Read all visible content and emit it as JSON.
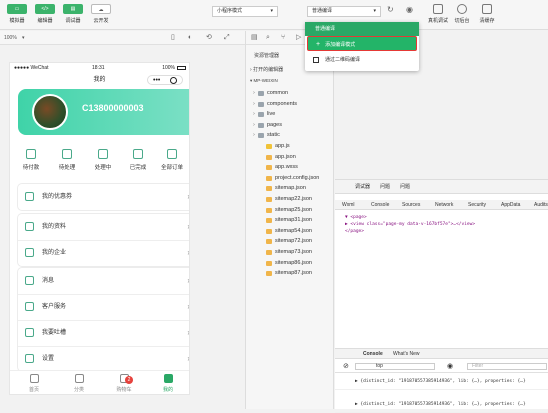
{
  "toolbar": {
    "left_buttons": [
      {
        "label": "模拟器",
        "icon": "phone-icon"
      },
      {
        "label": "编辑器",
        "icon": "code-icon"
      },
      {
        "label": "调试器",
        "icon": "debug-icon"
      },
      {
        "label": "云开发",
        "icon": "cloud-icon"
      }
    ],
    "mode_select": "小程序模式",
    "compile_select": "普通编译",
    "right_buttons": [
      {
        "label": "真机调试"
      },
      {
        "label": "切后台"
      },
      {
        "label": "清缓存"
      }
    ]
  },
  "simulator": {
    "zoom": "100%",
    "status": {
      "carrier": "●●●●● WeChat",
      "time": "18:31",
      "battery": "100%"
    },
    "nav_title": "我的",
    "user_phone": "C13800000003",
    "orders": [
      "待付款",
      "待处理",
      "处理中",
      "已完成",
      "全部订单"
    ],
    "menu_group1": [
      "我的优惠券"
    ],
    "menu_group2": [
      "我的资料",
      "我的企业"
    ],
    "menu_group3": [
      "消息",
      "客户服务",
      "我要吐槽",
      "设置"
    ],
    "tabs": [
      "首页",
      "分类",
      "购物车",
      "我的"
    ],
    "cart_badge": "2",
    "accent": "#3fd3a8"
  },
  "explorer": {
    "title": "资源管理器",
    "open_editors": "打开的编辑器",
    "project": "MP-WEIXIN",
    "items": [
      {
        "name": "common",
        "type": "folder"
      },
      {
        "name": "components",
        "type": "folder"
      },
      {
        "name": "live",
        "type": "folder"
      },
      {
        "name": "pages",
        "type": "folder"
      },
      {
        "name": "static",
        "type": "folder"
      },
      {
        "name": "app.js",
        "type": "js"
      },
      {
        "name": "app.json",
        "type": "json"
      },
      {
        "name": "app.wxss",
        "type": "css"
      },
      {
        "name": "project.config.json",
        "type": "json"
      },
      {
        "name": "sitemap.json",
        "type": "json"
      },
      {
        "name": "sitemap22.json",
        "type": "json"
      },
      {
        "name": "sitemap25.json",
        "type": "json"
      },
      {
        "name": "sitemap31.json",
        "type": "json"
      },
      {
        "name": "sitemap54.json",
        "type": "json"
      },
      {
        "name": "sitemap72.json",
        "type": "json"
      },
      {
        "name": "sitemap73.json",
        "type": "json"
      },
      {
        "name": "sitemap86.json",
        "type": "json"
      },
      {
        "name": "sitemap87.json",
        "type": "json"
      }
    ]
  },
  "dropdown": {
    "header": "普通编译",
    "add_mode": "添加编译模式",
    "qr_compile": "通过二维码编译"
  },
  "devtools": {
    "top_tabs": [
      "调试器",
      "问题",
      "问题"
    ],
    "tabs": [
      "Wxml",
      "Console",
      "Sources",
      "Network",
      "Security",
      "AppData",
      "Audits"
    ],
    "wxml_lines": [
      "▼ <page>",
      "  ▶ <view class=\"page-my data-v-167bf57e\">…</view>",
      "</page>"
    ],
    "console_tabs": [
      "Console",
      "What's New"
    ],
    "context": "top",
    "filter_placeholder": "Filter",
    "logs": [
      "▶ {distinct_id: \"191870557385914936\", lib: {…}, properties: {…}",
      "▶ {distinct_id: \"191870557385914936\", lib: {…}, properties: {…}"
    ]
  }
}
